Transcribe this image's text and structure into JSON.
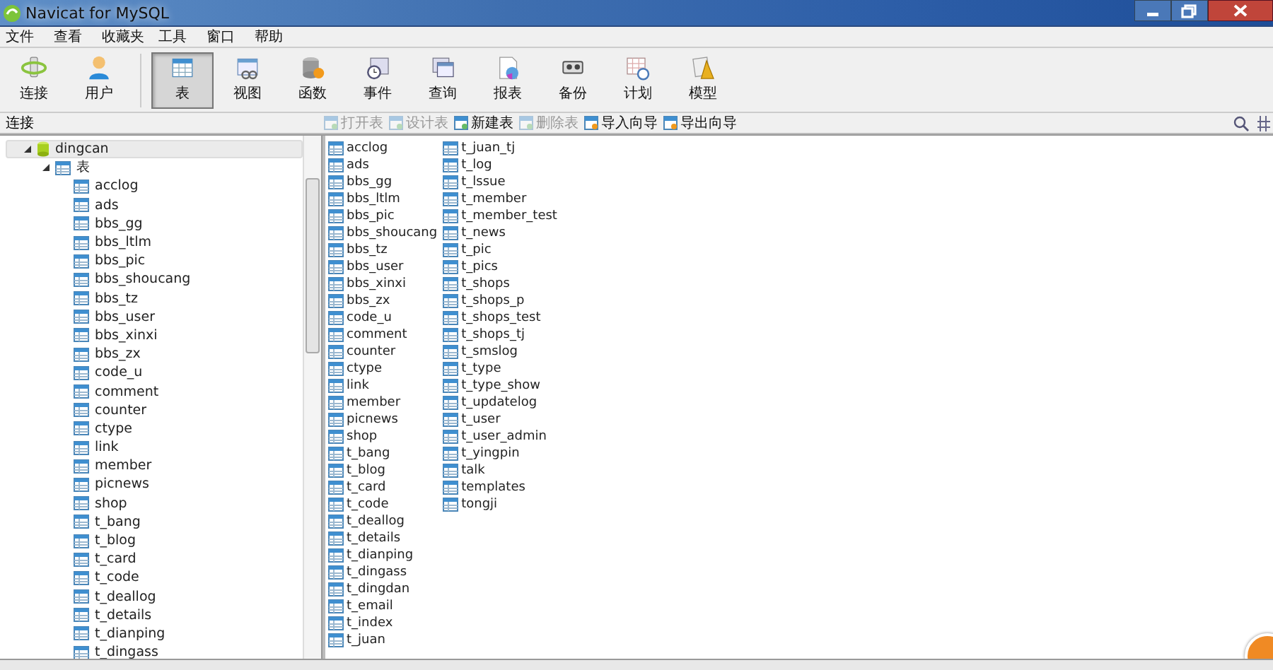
{
  "window": {
    "title": "Navicat for MySQL"
  },
  "menu": [
    "文件",
    "查看",
    "收藏夹",
    "工具",
    "窗口",
    "帮助"
  ],
  "toolbar": [
    {
      "label": "连接",
      "kind": "connect",
      "selected": false
    },
    {
      "label": "用户",
      "kind": "user",
      "selected": false
    },
    {
      "label": "表",
      "kind": "table",
      "selected": true
    },
    {
      "label": "视图",
      "kind": "view",
      "selected": false
    },
    {
      "label": "函数",
      "kind": "function",
      "selected": false
    },
    {
      "label": "事件",
      "kind": "event",
      "selected": false
    },
    {
      "label": "查询",
      "kind": "query",
      "selected": false
    },
    {
      "label": "报表",
      "kind": "report",
      "selected": false
    },
    {
      "label": "备份",
      "kind": "backup",
      "selected": false
    },
    {
      "label": "计划",
      "kind": "schedule",
      "selected": false
    },
    {
      "label": "模型",
      "kind": "model",
      "selected": false
    }
  ],
  "connection_label": "连接",
  "object_actions": [
    {
      "label": "打开表",
      "disabled": true
    },
    {
      "label": "设计表",
      "disabled": true
    },
    {
      "label": "新建表",
      "disabled": false
    },
    {
      "label": "删除表",
      "disabled": true
    },
    {
      "label": "导入向导",
      "disabled": false
    },
    {
      "label": "导出向导",
      "disabled": false
    }
  ],
  "sidebar": {
    "items": [
      {
        "label": "dingcan",
        "kind": "database",
        "selected": true,
        "expanded": true,
        "children": [
          {
            "label": "表",
            "kind": "folder",
            "selected": false,
            "expanded": true,
            "children": [
              {
                "label": "acclog",
                "kind": "table",
                "selected": false
              },
              {
                "label": "ads",
                "kind": "table",
                "selected": false
              },
              {
                "label": "bbs_gg",
                "kind": "table",
                "selected": false
              },
              {
                "label": "bbs_ltlm",
                "kind": "table",
                "selected": false
              },
              {
                "label": "bbs_pic",
                "kind": "table",
                "selected": false
              },
              {
                "label": "bbs_shoucang",
                "kind": "table",
                "selected": false
              },
              {
                "label": "bbs_tz",
                "kind": "table",
                "selected": false
              },
              {
                "label": "bbs_user",
                "kind": "table",
                "selected": false
              },
              {
                "label": "bbs_xinxi",
                "kind": "table",
                "selected": false
              },
              {
                "label": "bbs_zx",
                "kind": "table",
                "selected": false
              },
              {
                "label": "code_u",
                "kind": "table",
                "selected": false
              },
              {
                "label": "comment",
                "kind": "table",
                "selected": false
              },
              {
                "label": "counter",
                "kind": "table",
                "selected": false
              },
              {
                "label": "ctype",
                "kind": "table",
                "selected": false
              },
              {
                "label": "link",
                "kind": "table",
                "selected": false
              },
              {
                "label": "member",
                "kind": "table",
                "selected": false
              },
              {
                "label": "picnews",
                "kind": "table",
                "selected": false
              },
              {
                "label": "shop",
                "kind": "table",
                "selected": false
              },
              {
                "label": "t_bang",
                "kind": "table",
                "selected": false
              },
              {
                "label": "t_blog",
                "kind": "table",
                "selected": false
              },
              {
                "label": "t_card",
                "kind": "table",
                "selected": false
              },
              {
                "label": "t_code",
                "kind": "table",
                "selected": false
              },
              {
                "label": "t_deallog",
                "kind": "table",
                "selected": false
              },
              {
                "label": "t_details",
                "kind": "table",
                "selected": false
              },
              {
                "label": "t_dianping",
                "kind": "table",
                "selected": false
              },
              {
                "label": "t_dingass",
                "kind": "table",
                "selected": false
              }
            ]
          }
        ]
      }
    ]
  },
  "tables": [
    "acclog",
    "ads",
    "bbs_gg",
    "bbs_ltlm",
    "bbs_pic",
    "bbs_shoucang",
    "bbs_tz",
    "bbs_user",
    "bbs_xinxi",
    "bbs_zx",
    "code_u",
    "comment",
    "counter",
    "ctype",
    "link",
    "member",
    "picnews",
    "shop",
    "t_bang",
    "t_blog",
    "t_card",
    "t_code",
    "t_deallog",
    "t_details",
    "t_dianping",
    "t_dingass",
    "t_dingdan",
    "t_email",
    "t_index",
    "t_juan",
    "t_juan_tj",
    "t_log",
    "t_lssue",
    "t_member",
    "t_member_test",
    "t_news",
    "t_pic",
    "t_pics",
    "t_shops",
    "t_shops_p",
    "t_shops_test",
    "t_shops_tj",
    "t_smslog",
    "t_type",
    "t_type_show",
    "t_updatelog",
    "t_user",
    "t_user_admin",
    "t_yingpin",
    "talk",
    "templates",
    "tongji"
  ]
}
